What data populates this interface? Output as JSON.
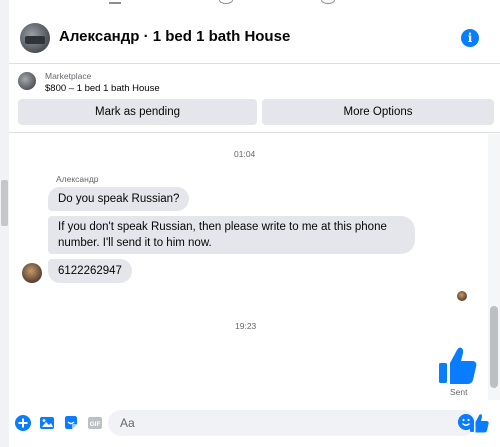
{
  "header": {
    "title": "Александр · 1 bed 1 bath House"
  },
  "listing": {
    "label": "Marketplace",
    "subtitle": "$800 – 1 bed 1 bath House",
    "mark_pending": "Mark as pending",
    "more_options": "More Options"
  },
  "messages": {
    "time1": "01:04",
    "sender": "Александр",
    "m1": "Do you speak Russian?",
    "m2": "If you don't speak Russian, then please write to me at this phone number. I'll send it to him now.",
    "m3": "6122262947",
    "time2": "19:23",
    "sent_status": "Sent"
  },
  "composer": {
    "placeholder": "Aa",
    "icons": [
      "plus-icon",
      "image-icon",
      "sticker-icon",
      "gif-icon",
      "emoji-icon",
      "like-icon"
    ]
  },
  "colors": {
    "accent": "#0a7cff",
    "bubble": "#e4e6eb",
    "muted_text": "#65676b"
  }
}
